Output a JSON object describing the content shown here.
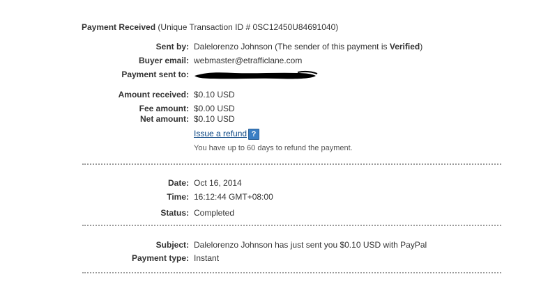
{
  "header": {
    "title": "Payment Received",
    "subtitle": "(Unique Transaction ID # 0SC12450U84691040)"
  },
  "details": {
    "sent_by_label": "Sent by:",
    "sent_by_name": "Dalelorenzo Johnson",
    "sent_by_note_prefix": "(The sender of this payment is",
    "sent_by_status": "Verified",
    "sent_by_note_suffix": ")",
    "buyer_email_label": "Buyer email:",
    "buyer_email": "webmaster@etrafficlane.com",
    "payment_sent_to_label": "Payment sent to:"
  },
  "amounts": {
    "received_label": "Amount received:",
    "received": "$0.10 USD",
    "fee_label": "Fee amount:",
    "fee": "$0.00 USD",
    "net_label": "Net amount:",
    "net": "$0.10 USD",
    "refund_link": "Issue a refund",
    "help_icon_text": "?",
    "refund_note": "You have up to 60 days to refund the payment."
  },
  "timing": {
    "date_label": "Date:",
    "date": "Oct 16, 2014",
    "time_label": "Time:",
    "time": "16:12:44 GMT+08:00",
    "status_label": "Status:",
    "status": "Completed"
  },
  "extra": {
    "subject_label": "Subject:",
    "subject": "Dalelorenzo Johnson has just sent you $0.10 USD with PayPal",
    "payment_type_label": "Payment type:",
    "payment_type": "Instant"
  },
  "colors": {
    "link": "#084482",
    "help_icon_bg": "#3b7fc4",
    "divider": "#9a9a9a",
    "redaction": "#000000"
  }
}
